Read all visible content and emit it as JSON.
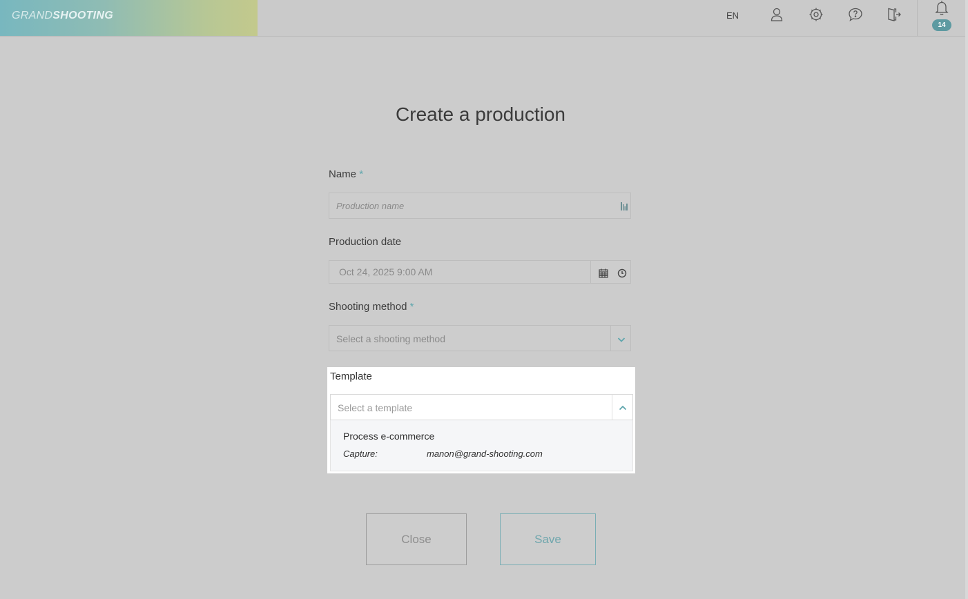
{
  "header": {
    "logo_part1": "GRAND",
    "logo_part2": "SHOOTING",
    "language": "EN",
    "notification_count": "14",
    "icons": [
      "user-icon",
      "settings-icon",
      "help-icon",
      "logout-icon",
      "bell-icon"
    ]
  },
  "form": {
    "title": "Create a production",
    "required_marker": "*",
    "name": {
      "label": "Name",
      "placeholder": "Production name"
    },
    "production_date": {
      "label": "Production date",
      "value": "Oct 24, 2025 9:00 AM"
    },
    "shooting_method": {
      "label": "Shooting method",
      "placeholder": "Select a shooting method"
    },
    "template": {
      "label": "Template",
      "placeholder": "Select a template",
      "options": [
        {
          "name": "Process e-commerce",
          "capture_label": "Capture:",
          "capture_value": "manon@grand-shooting.com"
        }
      ]
    }
  },
  "buttons": {
    "close": "Close",
    "save": "Save"
  },
  "colors": {
    "accent": "#5fa6ad",
    "overlay": "#cccccc",
    "panel": "#ffffff"
  }
}
